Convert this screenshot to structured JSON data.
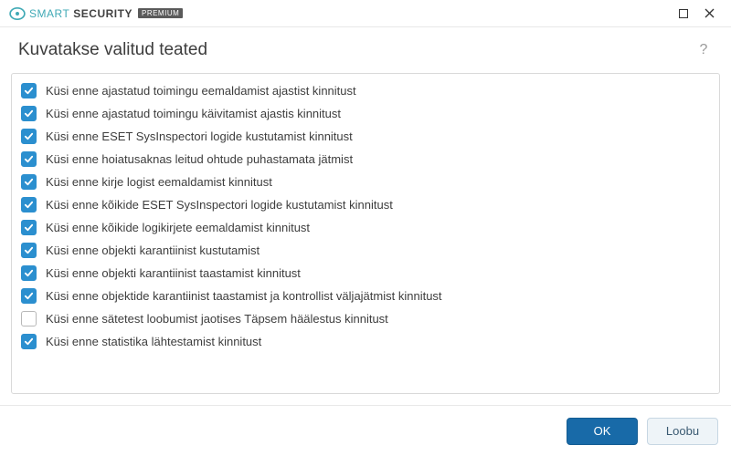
{
  "brand": {
    "text1": "SMART",
    "text2": "SECURITY",
    "badge": "PREMIUM"
  },
  "header": {
    "title": "Kuvatakse valitud teated",
    "help": "?"
  },
  "list": [
    {
      "checked": true,
      "label": "Küsi enne ajastatud toimingu eemaldamist ajastist kinnitust"
    },
    {
      "checked": true,
      "label": "Küsi enne ajastatud toimingu käivitamist ajastis kinnitust"
    },
    {
      "checked": true,
      "label": "Küsi enne ESET SysInspectori logide kustutamist kinnitust"
    },
    {
      "checked": true,
      "label": "Küsi enne hoiatusaknas leitud ohtude puhastamata jätmist"
    },
    {
      "checked": true,
      "label": "Küsi enne kirje logist eemaldamist kinnitust"
    },
    {
      "checked": true,
      "label": "Küsi enne kõikide ESET SysInspectori logide kustutamist kinnitust"
    },
    {
      "checked": true,
      "label": "Küsi enne kõikide logikirjete eemaldamist kinnitust"
    },
    {
      "checked": true,
      "label": "Küsi enne objekti karantiinist kustutamist"
    },
    {
      "checked": true,
      "label": "Küsi enne objekti karantiinist taastamist kinnitust"
    },
    {
      "checked": true,
      "label": "Küsi enne objektide karantiinist taastamist ja kontrollist väljajätmist kinnitust"
    },
    {
      "checked": false,
      "label": "Küsi enne sätetest loobumist jaotises Täpsem häälestus kinnitust"
    },
    {
      "checked": true,
      "label": "Küsi enne statistika lähtestamist kinnitust"
    }
  ],
  "footer": {
    "ok": "OK",
    "cancel": "Loobu"
  }
}
